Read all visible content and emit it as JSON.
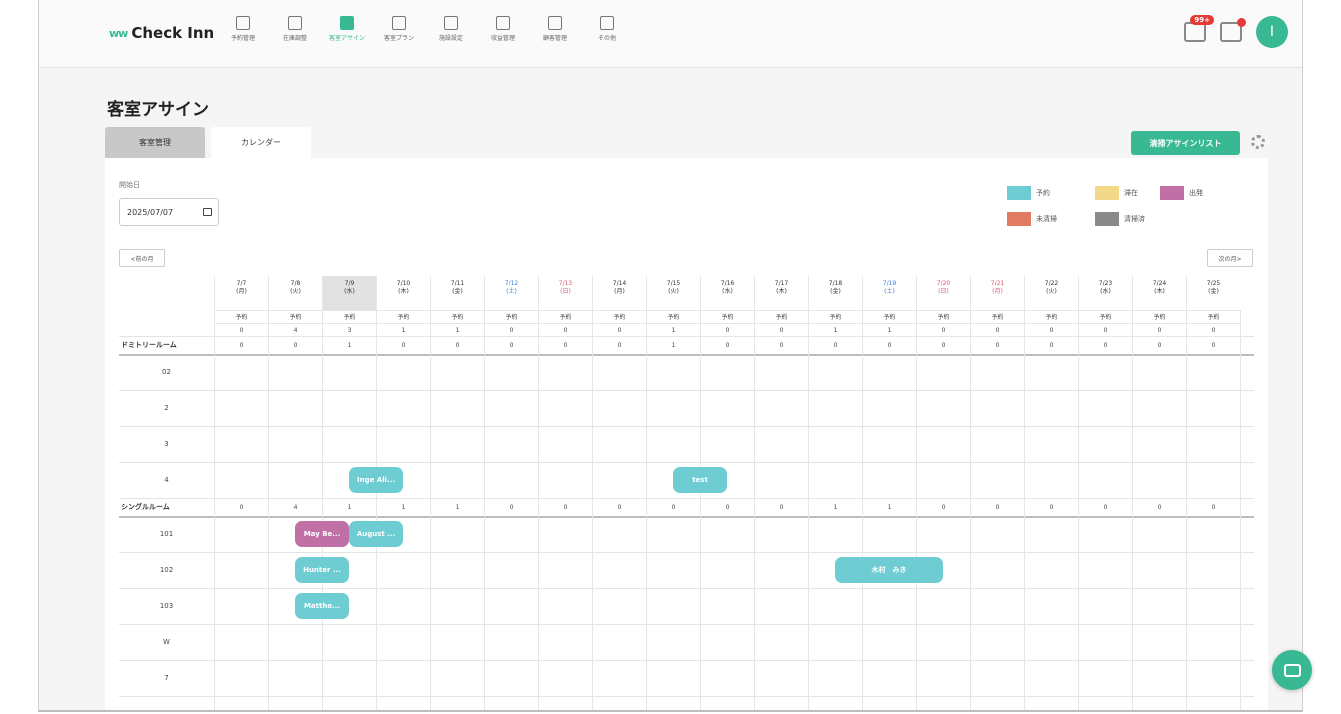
{
  "app": {
    "name": "Check Inn",
    "logo_mark": "ww"
  },
  "nav": [
    {
      "label": "予約管理",
      "icon": "calendar-icon",
      "active": false
    },
    {
      "label": "在庫調整",
      "icon": "inventory-icon",
      "active": false
    },
    {
      "label": "客室アサイン",
      "icon": "door-icon",
      "active": true
    },
    {
      "label": "客室プラン",
      "icon": "plan-icon",
      "active": false
    },
    {
      "label": "施設設定",
      "icon": "building-icon",
      "active": false
    },
    {
      "label": "収益管理",
      "icon": "revenue-icon",
      "active": false
    },
    {
      "label": "顧客管理",
      "icon": "users-icon",
      "active": false
    },
    {
      "label": "その他",
      "icon": "gear-icon",
      "active": false
    }
  ],
  "header_right": {
    "notification_badge": "99+",
    "avatar_letter": "I"
  },
  "page": {
    "title": "客室アサイン"
  },
  "tabs": {
    "room_management": "客室管理",
    "calendar": "カレンダー"
  },
  "clean_assign_button": "清掃アサインリスト",
  "start_date": {
    "label": "開始日",
    "value": "2025/07/07"
  },
  "legend": [
    {
      "label": "予約",
      "color": "#6ecdd3"
    },
    {
      "label": "滞在",
      "color": "#f2d98a"
    },
    {
      "label": "出発",
      "color": "#c170a6"
    },
    {
      "label": "未清掃",
      "color": "#e07b62"
    },
    {
      "label": "清掃済",
      "color": "#8a8a8a"
    }
  ],
  "pager": {
    "prev": "<前の月",
    "next": "次の月>"
  },
  "dates": [
    {
      "date": "7/7",
      "dow": "(月)",
      "kind": "weekday"
    },
    {
      "date": "7/8",
      "dow": "(火)",
      "kind": "weekday"
    },
    {
      "date": "7/9",
      "dow": "(水)",
      "kind": "today"
    },
    {
      "date": "7/10",
      "dow": "(木)",
      "kind": "weekday"
    },
    {
      "date": "7/11",
      "dow": "(金)",
      "kind": "weekday"
    },
    {
      "date": "7/12",
      "dow": "(土)",
      "kind": "sat"
    },
    {
      "date": "7/13",
      "dow": "(日)",
      "kind": "sun"
    },
    {
      "date": "7/14",
      "dow": "(月)",
      "kind": "weekday"
    },
    {
      "date": "7/15",
      "dow": "(火)",
      "kind": "weekday"
    },
    {
      "date": "7/16",
      "dow": "(水)",
      "kind": "weekday"
    },
    {
      "date": "7/17",
      "dow": "(木)",
      "kind": "weekday"
    },
    {
      "date": "7/18",
      "dow": "(金)",
      "kind": "weekday"
    },
    {
      "date": "7/19",
      "dow": "(土)",
      "kind": "sat"
    },
    {
      "date": "7/20",
      "dow": "(日)",
      "kind": "sun"
    },
    {
      "date": "7/21",
      "dow": "(月)",
      "kind": "holiday"
    },
    {
      "date": "7/22",
      "dow": "(火)",
      "kind": "weekday"
    },
    {
      "date": "7/23",
      "dow": "(水)",
      "kind": "weekday"
    },
    {
      "date": "7/24",
      "dow": "(木)",
      "kind": "weekday"
    },
    {
      "date": "7/25",
      "dow": "(金)",
      "kind": "weekday"
    }
  ],
  "status_row_label": "予約",
  "total_counts": [
    0,
    4,
    3,
    1,
    1,
    0,
    0,
    0,
    1,
    0,
    0,
    1,
    1,
    0,
    0,
    0,
    0,
    0,
    0
  ],
  "date_colors": {
    "weekday": "#333333",
    "today": "#333333",
    "sat": "#3b7dd8",
    "sun": "#e0506a",
    "holiday": "#e0506a"
  },
  "categories": [
    {
      "name": "ドミトリールーム",
      "counts": [
        0,
        0,
        1,
        0,
        0,
        0,
        0,
        0,
        1,
        0,
        0,
        0,
        0,
        0,
        0,
        0,
        0,
        0,
        0
      ],
      "rooms": [
        "02",
        "2",
        "3",
        "4"
      ]
    },
    {
      "name": "シングルルーム",
      "counts": [
        0,
        4,
        1,
        1,
        1,
        0,
        0,
        0,
        0,
        0,
        0,
        1,
        1,
        0,
        0,
        0,
        0,
        0,
        0
      ],
      "rooms": [
        "101",
        "102",
        "103",
        "W",
        "7"
      ]
    }
  ],
  "reservations": [
    {
      "guest": "Inge Ali...",
      "room": "4",
      "start": 2,
      "days": 1,
      "status": "teal"
    },
    {
      "guest": "test",
      "room": "4",
      "start": 8,
      "days": 1,
      "status": "teal"
    },
    {
      "guest": "May Be...",
      "room": "101",
      "start": 1,
      "days": 1,
      "status": "pink"
    },
    {
      "guest": "August ...",
      "room": "101",
      "start": 2,
      "days": 1,
      "status": "teal"
    },
    {
      "guest": "Hunter ...",
      "room": "102",
      "start": 1,
      "days": 1,
      "status": "teal"
    },
    {
      "guest": "木村　みき",
      "room": "102",
      "start": 11,
      "days": 2,
      "status": "teal"
    },
    {
      "guest": "Matthe...",
      "room": "103",
      "start": 1,
      "days": 1,
      "status": "teal"
    }
  ]
}
